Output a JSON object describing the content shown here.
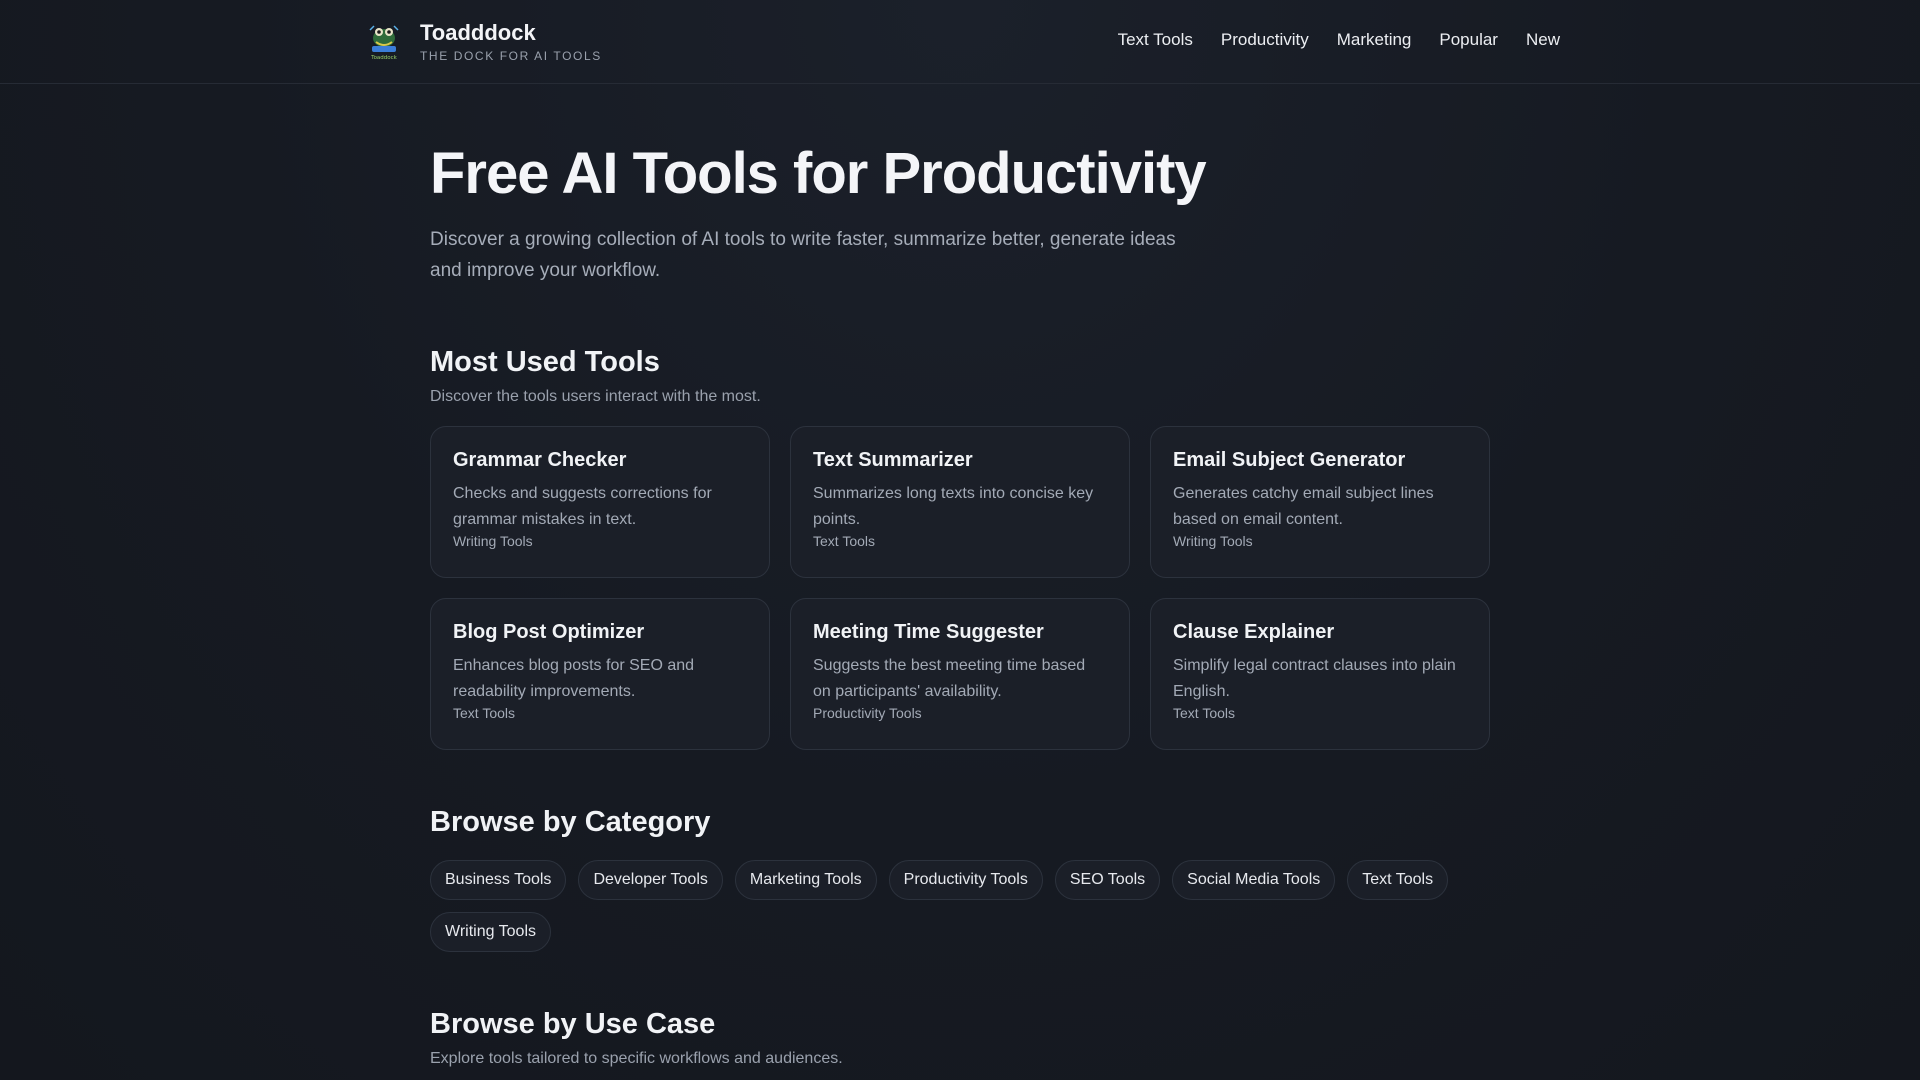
{
  "header": {
    "brand_name": "Toadddock",
    "tagline": "THE DOCK FOR AI TOOLS",
    "logo_text": "Toaddock",
    "nav": [
      {
        "label": "Text Tools"
      },
      {
        "label": "Productivity"
      },
      {
        "label": "Marketing"
      },
      {
        "label": "Popular"
      },
      {
        "label": "New"
      }
    ]
  },
  "hero": {
    "title": "Free AI Tools for Productivity",
    "subtitle": "Discover a growing collection of AI tools to write faster, summarize better, generate ideas and improve your workflow."
  },
  "most_used": {
    "title": "Most Used Tools",
    "subtitle": "Discover the tools users interact with the most.",
    "tools": [
      {
        "name": "Grammar Checker",
        "description": "Checks and suggests corrections for grammar mistakes in text.",
        "category": "Writing Tools"
      },
      {
        "name": "Text Summarizer",
        "description": "Summarizes long texts into concise key points.",
        "category": "Text Tools"
      },
      {
        "name": "Email Subject Generator",
        "description": "Generates catchy email subject lines based on email content.",
        "category": "Writing Tools"
      },
      {
        "name": "Blog Post Optimizer",
        "description": "Enhances blog posts for SEO and readability improvements.",
        "category": "Text Tools"
      },
      {
        "name": "Meeting Time Suggester",
        "description": "Suggests the best meeting time based on participants' availability.",
        "category": "Productivity Tools"
      },
      {
        "name": "Clause Explainer",
        "description": "Simplify legal contract clauses into plain English.",
        "category": "Text Tools"
      }
    ]
  },
  "categories": {
    "title": "Browse by Category",
    "items": [
      {
        "label": "Business Tools"
      },
      {
        "label": "Developer Tools"
      },
      {
        "label": "Marketing Tools"
      },
      {
        "label": "Productivity Tools"
      },
      {
        "label": "SEO Tools"
      },
      {
        "label": "Social Media Tools"
      },
      {
        "label": "Text Tools"
      },
      {
        "label": "Writing Tools"
      }
    ]
  },
  "use_case": {
    "title": "Browse by Use Case",
    "subtitle": "Explore tools tailored to specific workflows and audiences."
  }
}
